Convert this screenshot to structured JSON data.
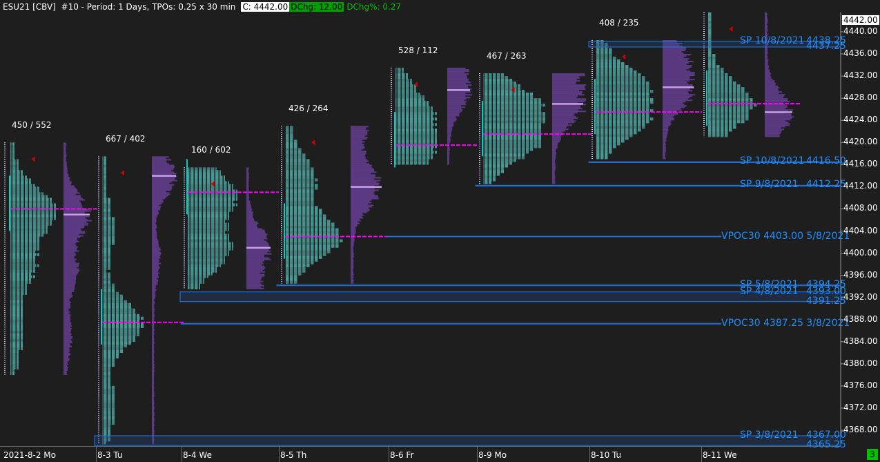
{
  "header": {
    "title": "ESU21 [CBV]  #10 - Period: 1 Days, TPOs: 0.25 x 30 min",
    "close": "C: 4442.00",
    "dchg": "DChg: 12.00",
    "dchg_pct": "DChg%: 0.27"
  },
  "colors": {
    "tpo": "#3f8f8c",
    "tpo_dark": "#2a5250",
    "volume": "#5b3a82",
    "poc": "#ff00ff",
    "vpoc": "#c9a0e8",
    "ref": "#1e90ff",
    "bg": "#1e1e1e"
  },
  "axis": {
    "last_price": "4442.00",
    "ticks": [
      "4440.00",
      "4436.00",
      "4432.00",
      "4428.00",
      "4424.00",
      "4420.00",
      "4416.00",
      "4412.00",
      "4408.00",
      "4404.00",
      "4400.00",
      "4396.00",
      "4392.00",
      "4388.00",
      "4384.00",
      "4380.00",
      "4376.00",
      "4372.00",
      "4368.00"
    ],
    "min": 4364,
    "max": 4444
  },
  "days": [
    {
      "date": "2021-8-2 Mo",
      "label": "450 / 552",
      "high": 4420,
      "low": 4378,
      "poc": 4408,
      "vpoc": 4407
    },
    {
      "date": "8-3 Tu",
      "label": "667 / 402",
      "high": 4417.5,
      "low": 4365.5,
      "poc": 4387.5,
      "vpoc": 4414
    },
    {
      "date": "8-4 We",
      "label": "160 / 602",
      "high": 4415.5,
      "low": 4393.5,
      "poc": 4411,
      "vpoc": 4401
    },
    {
      "date": "8-5 Th",
      "label": "426 / 264",
      "high": 4423,
      "low": 4394.5,
      "poc": 4403,
      "vpoc": 4412
    },
    {
      "date": "8-6 Fr",
      "label": "528 / 112",
      "high": 4433.5,
      "low": 4416,
      "poc": 4419.5,
      "vpoc": 4429.5
    },
    {
      "date": "8-9 Mo",
      "label": "467 / 263",
      "high": 4432.5,
      "low": 4412.5,
      "poc": 4421.5,
      "vpoc": 4427
    },
    {
      "date": "8-10 Tu",
      "label": "408 / 235",
      "high": 4438.5,
      "low": 4417,
      "poc": 4425.5,
      "vpoc": 4430
    },
    {
      "date": "8-11 We",
      "label": "",
      "high": 4443.5,
      "low": 4421,
      "poc": 4427,
      "vpoc": 4425.5
    }
  ],
  "references": [
    {
      "text": "SP 10/8/2021",
      "price": 4438.25,
      "value": "4438.25",
      "price2": 4437.25,
      "value2": "4437.25"
    },
    {
      "text": "SP 10/8/2021",
      "price": 4416.5,
      "value": "4416.50"
    },
    {
      "text": "SP 9/8/2021",
      "price": 4412.25,
      "value": "4412.25"
    },
    {
      "text": "VPOC30 4403.00 5/8/2021",
      "price": 4403,
      "vpoc": true
    },
    {
      "text": "SP 5/8/2021",
      "price": 4394.25,
      "value": "4394.25"
    },
    {
      "text": "SP 4/8/2021",
      "price": 4393,
      "value": "4393.00",
      "price2": 4391.25,
      "value2": "4391.25"
    },
    {
      "text": "VPOC30 4387.25 3/8/2021",
      "price": 4387.25,
      "vpoc": true
    },
    {
      "text": "SP 3/8/2021",
      "price": 4367,
      "value": "4367.00",
      "price2": 4365.25,
      "value2": "4365.25"
    }
  ],
  "status_badge": "3"
}
